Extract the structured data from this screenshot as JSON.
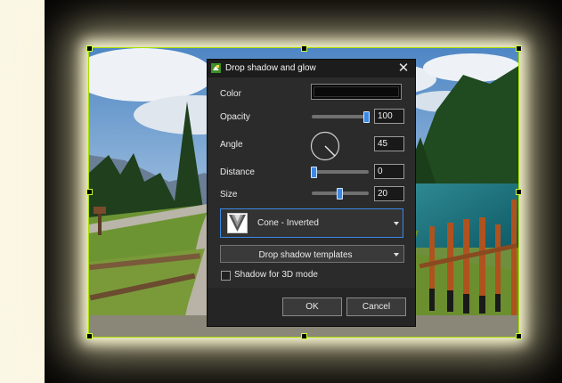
{
  "dialog": {
    "title": "Drop shadow and glow",
    "close_glyph": "✕",
    "color_label": "Color",
    "color_value": "#0a0a0a",
    "opacity_label": "Opacity",
    "opacity_value": "100",
    "opacity_level": 1.0,
    "angle_label": "Angle",
    "angle_value": "45",
    "distance_label": "Distance",
    "distance_value": "0",
    "distance_level": 0.0,
    "size_label": "Size",
    "size_value": "20",
    "size_level": 0.5,
    "shape_selected": "Cone - Inverted",
    "templates_label": "Drop shadow templates",
    "shadow3d_label": "Shadow for 3D mode",
    "shadow3d_checked": false,
    "ok_label": "OK",
    "cancel_label": "Cancel"
  },
  "icons": {
    "title": "app-icon",
    "close": "close-icon",
    "dropdown": "chevron-down-icon"
  },
  "colors": {
    "dialog_bg": "#2b2b2b",
    "accent": "#3b88e6",
    "selection": "#a8e000",
    "glow": "#fffbd7",
    "side_panel": "#fbf7e6"
  }
}
